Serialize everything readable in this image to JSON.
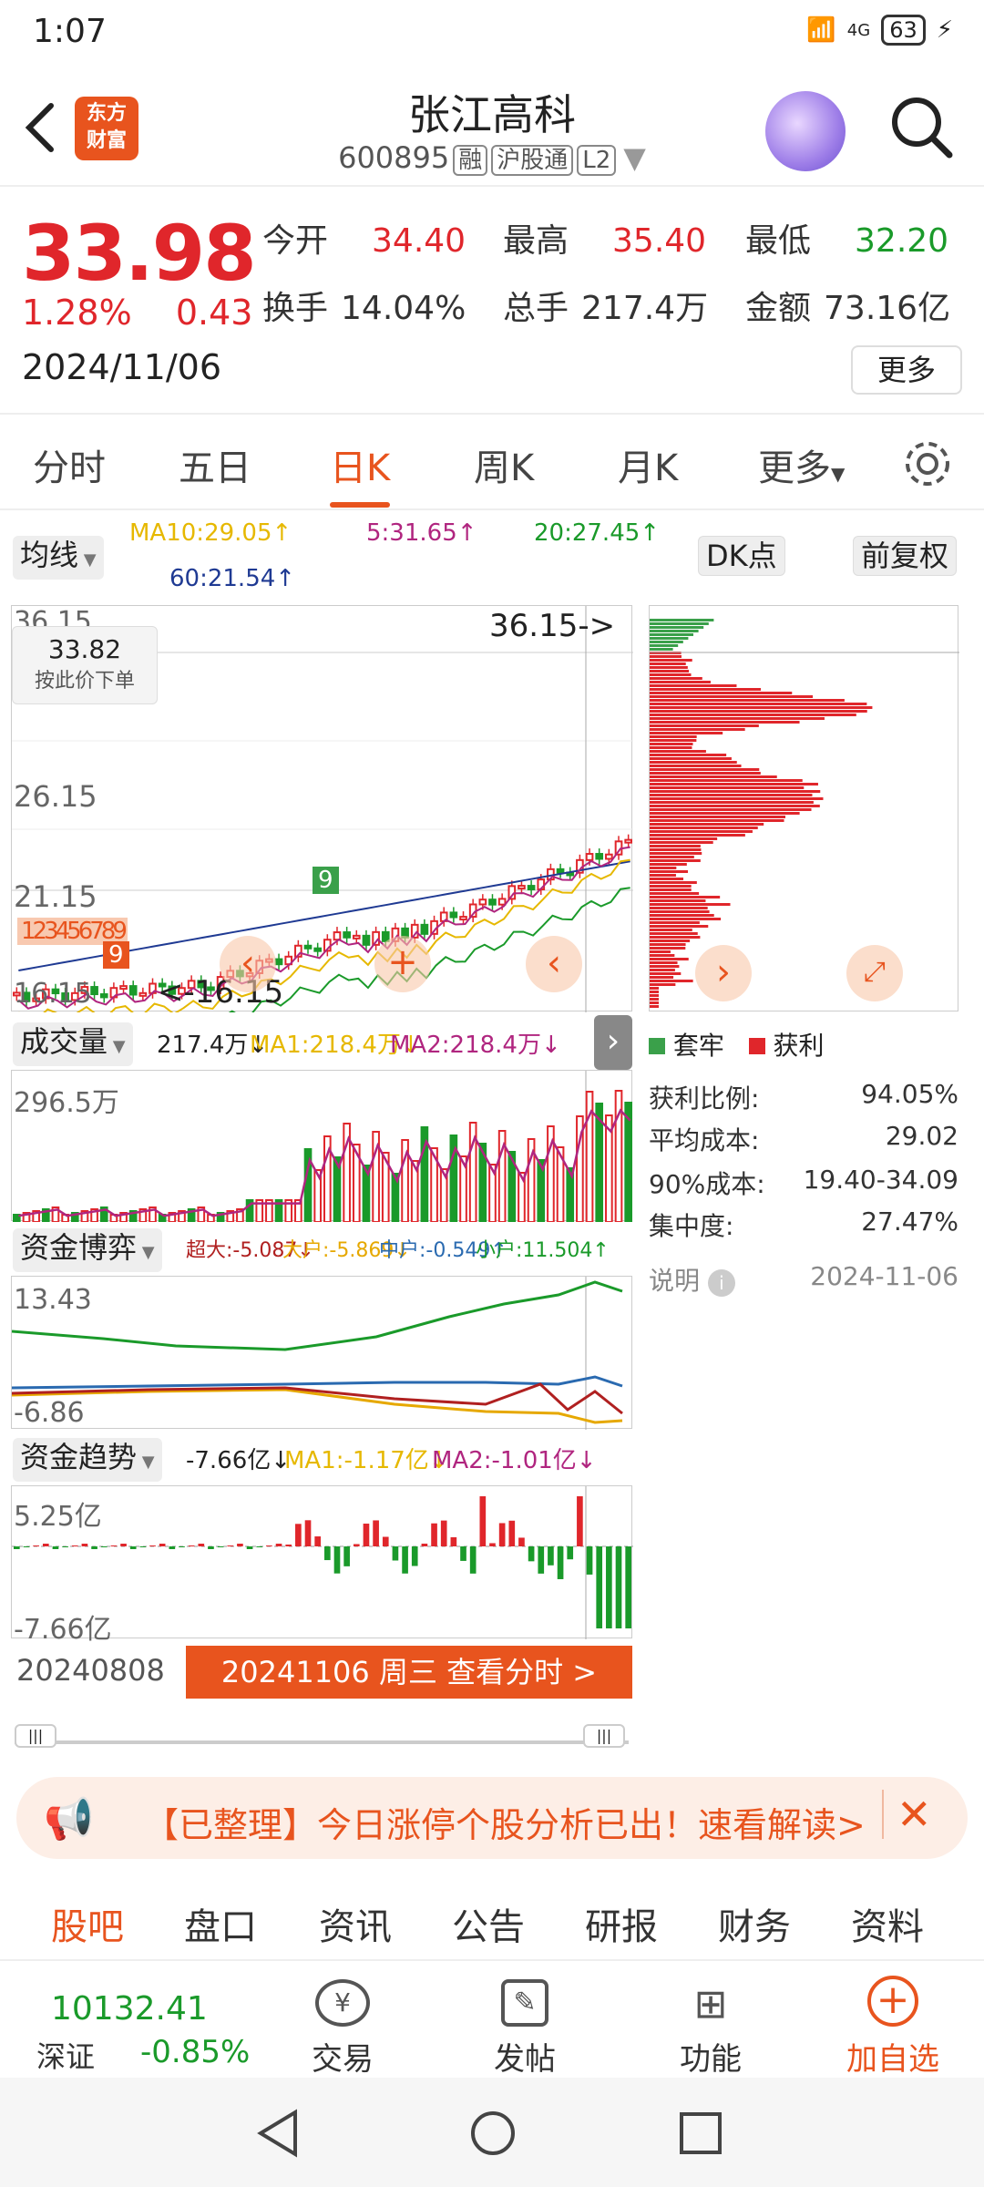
{
  "status": {
    "time": "1:07",
    "network": "4G",
    "battery": "63"
  },
  "header": {
    "title": "张江高科",
    "code": "600895",
    "tags": [
      "融",
      "沪股通",
      "L2"
    ],
    "logo_line1": "东方",
    "logo_line2": "财富"
  },
  "quote": {
    "price": "33.98",
    "change_pct": "1.28%",
    "change": "0.43",
    "date": "2024/11/06",
    "open_label": "今开",
    "open": "34.40",
    "high_label": "最高",
    "high": "35.40",
    "low_label": "最低",
    "low": "32.20",
    "turnover_label": "换手",
    "turnover": "14.04%",
    "volume_label": "总手",
    "volume": "217.4万",
    "amount_label": "金额",
    "amount": "73.16亿",
    "more": "更多"
  },
  "tabs": [
    "分时",
    "五日",
    "日K",
    "周K",
    "月K",
    "更多"
  ],
  "active_tab": "日K",
  "ma": {
    "selector": "均线",
    "ma10": "MA10:29.05↑",
    "ma5": "5:31.65↑",
    "ma20": "20:27.45↑",
    "ma60": "60:21.54↑",
    "dk": "DK点",
    "adjust": "前复权"
  },
  "kline": {
    "yaxis": [
      "36.15",
      "26.15",
      "21.15",
      "16.15"
    ],
    "tooltip_price": "33.82",
    "tooltip_text": "按此价下单",
    "max_label": "36.15->",
    "min_label": "<-16.15",
    "signals_a": "123456789",
    "signal_9": "9"
  },
  "volume": {
    "selector": "成交量",
    "value": "217.4万↓",
    "ma1": "MA1:218.4万↓",
    "ma2": "MA2:218.4万↓",
    "max_label": "296.5万"
  },
  "fund_game": {
    "selector": "资金博弈",
    "big": "超大:-5.087↓",
    "large": "大户:-5.869↓",
    "mid": "中户:-0.549↑",
    "small": "小户:11.504↑",
    "top": "13.43",
    "bottom": "-6.86"
  },
  "fund_trend": {
    "selector": "资金趋势",
    "value": "-7.66亿↓",
    "ma1": "MA1:-1.17亿↓",
    "ma2": "MA2:-1.01亿↓",
    "top": "5.25亿",
    "bottom": "-7.66亿"
  },
  "timeline": {
    "start": "20240808",
    "cta": "20241106 周三 查看分时 >"
  },
  "chips": {
    "legend_hold": "套牢",
    "legend_profit": "获利",
    "rows": [
      {
        "label": "获利比例:",
        "value": "94.05%"
      },
      {
        "label": "平均成本:",
        "value": "29.02"
      },
      {
        "label": "90%成本:",
        "value": "19.40-34.09"
      },
      {
        "label": "集中度:",
        "value": "27.47%"
      }
    ],
    "note": "说明",
    "note_date": "2024-11-06"
  },
  "banner": {
    "text": "【已整理】今日涨停个股分析已出！速看解读>"
  },
  "bottom_tabs": [
    "股吧",
    "盘口",
    "资讯",
    "公告",
    "研报",
    "财务",
    "资料"
  ],
  "bottom_bar": {
    "index_value": "10132.41",
    "index_name": "深证",
    "index_change": "-0.85%",
    "trade": "交易",
    "post": "发帖",
    "features": "功能",
    "add": "加自选"
  },
  "colors": {
    "accent": "#e8541e",
    "up": "#e0262b",
    "down": "#1a9a2a",
    "ma5": "#b0257f",
    "ma10": "#e6b800",
    "ma20": "#1a9a2a",
    "ma60": "#1f3a93"
  }
}
